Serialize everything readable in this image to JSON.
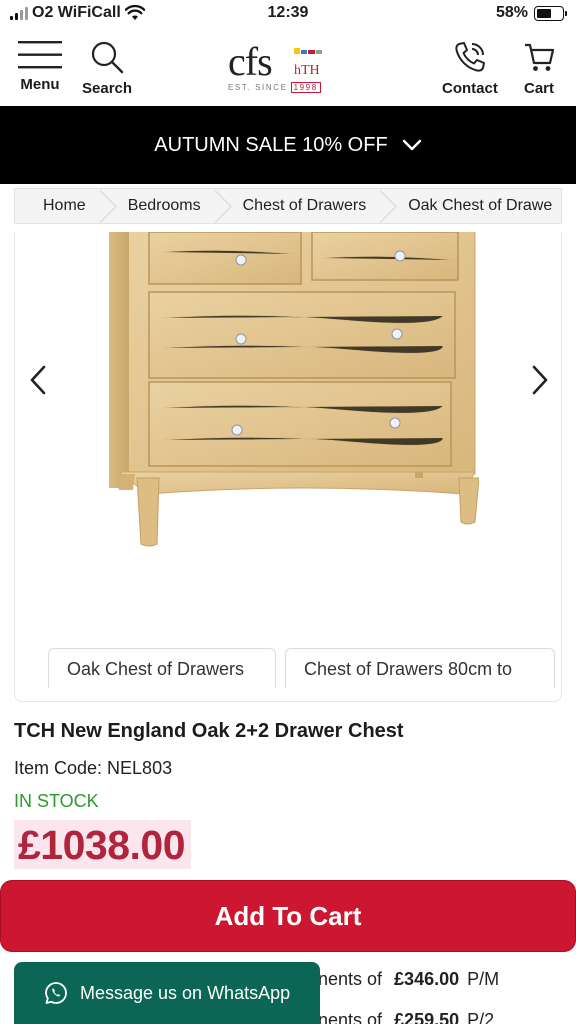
{
  "status_bar": {
    "carrier": "O2 WiFiCall",
    "time": "12:39",
    "battery": "58%",
    "battery_level": 0.58
  },
  "header": {
    "menu_label": "Menu",
    "search_label": "Search",
    "contact_label": "Contact",
    "cart_label": "Cart",
    "logo_text": "cfs",
    "logo_mark_text": "hTH",
    "logo_est": "EST. SINCE",
    "logo_year": "1998"
  },
  "banner": {
    "text": "AUTUMN SALE 10% OFF"
  },
  "breadcrumb": [
    "Home",
    "Bedrooms",
    "Chest of Drawers",
    "Oak Chest of Drawe"
  ],
  "gallery": {
    "thumbs": [
      "Oak Chest of Drawers",
      "Chest of Drawers 80cm to"
    ]
  },
  "product": {
    "title": "TCH New England Oak 2+2 Drawer Chest",
    "item_code": "Item Code: NEL803",
    "stock": "IN STOCK",
    "price": "£1038.00"
  },
  "actions": {
    "add_to_cart": "Add To Cart"
  },
  "installments": [
    {
      "prefix": "nents of",
      "amount": "£346.00",
      "suffix": "P/M"
    },
    {
      "prefix": "nents of",
      "amount": "£259.50",
      "suffix": "P/2"
    }
  ],
  "whatsapp": {
    "label": "Message us on WhatsApp"
  },
  "colors": {
    "accent_red": "#cd1730",
    "price_color": "#b0243e",
    "stock_green": "#2e9a2e",
    "whatsapp_green": "#0b6655",
    "banner_bg": "#000000"
  }
}
